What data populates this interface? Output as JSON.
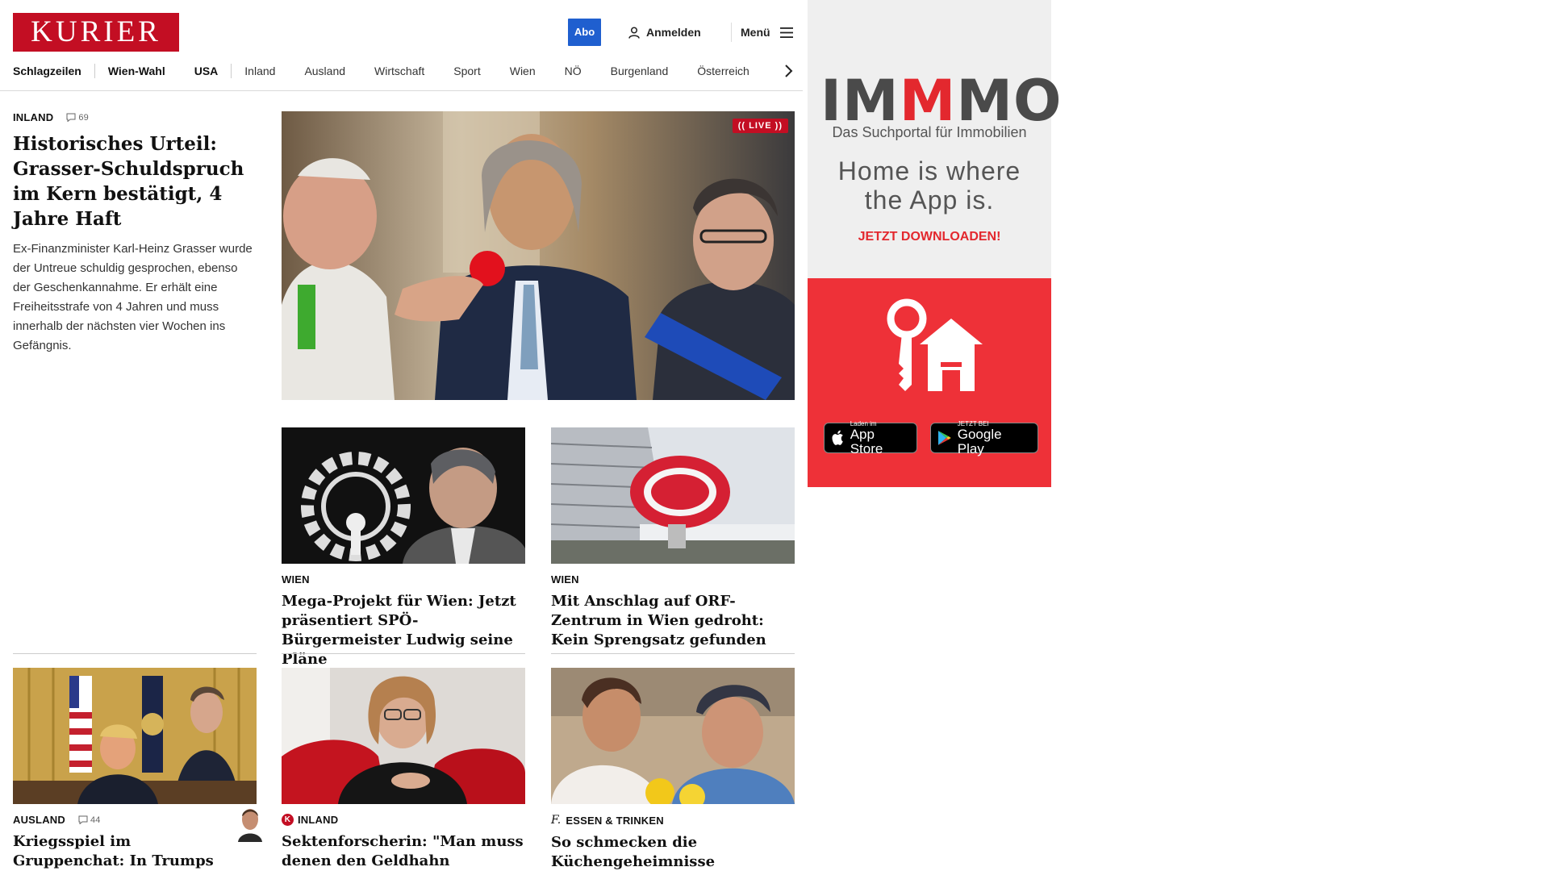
{
  "header": {
    "logo_text": "KURIER",
    "abo_label": "Abo",
    "login_label": "Anmelden",
    "menu_label": "Menü"
  },
  "nav": {
    "items": [
      "Schlagzeilen",
      "Wien-Wahl",
      "USA",
      "Inland",
      "Ausland",
      "Wirtschaft",
      "Sport",
      "Wien",
      "NÖ",
      "Burgenland",
      "Österreich"
    ]
  },
  "lead": {
    "kicker": "INLAND",
    "comments": "69",
    "title": "Historisches Urteil: Grasser-Schuldspruch im Kern bestätigt, 4 Jahre Haft",
    "description": "Ex-Finanzminister Karl-Heinz Grasser wurde der Untreue schuldig gesprochen, ebenso der Geschenkannahme. Er erhält eine Freiheitsstrafe von 4 Jahren und muss innerhalb der nächsten vier Wochen ins Gefängnis.",
    "live_label": "LIVE"
  },
  "cards": [
    {
      "kicker": "WIEN",
      "title": "Mega-Projekt für Wien: Jetzt präsentiert SPÖ-Bürgermeister Ludwig seine Pläne"
    },
    {
      "kicker": "WIEN",
      "title": "Mit Anschlag auf ORF-Zentrum in Wien gedroht: Kein Sprengsatz gefunden"
    },
    {
      "kicker": "AUSLAND",
      "comments": "44",
      "title": "Kriegsspiel im Gruppenchat: In Trumps Team müssen jetzt Köpfe"
    },
    {
      "kicker": "INLAND",
      "brand": "K",
      "title": "Sektenforscherin: \"Man muss denen den Geldhahn abdrehen\""
    },
    {
      "kicker": "ESSEN & TRINKEN",
      "brand": "f.",
      "title": "So schmecken die Küchengeheimnisse griechischer Omas"
    }
  ],
  "ad": {
    "brand_parts": [
      "IM",
      "M",
      "MO"
    ],
    "subtitle": "Das Suchportal für Immobilien",
    "slogan_line1": "Home is where",
    "slogan_line2": "the App is.",
    "cta": "JETZT DOWNLOADEN!",
    "appstore_small": "Laden im",
    "appstore_big": "App Store",
    "googleplay_small": "JETZT BEI",
    "googleplay_big": "Google Play",
    "colors": {
      "brand_red": "#e3282e",
      "ad_bg": "#efefef"
    }
  },
  "colors": {
    "kurier_red": "#c30e23",
    "abo_blue": "#1f5fcf"
  }
}
